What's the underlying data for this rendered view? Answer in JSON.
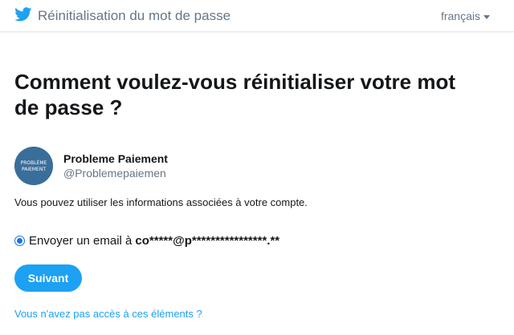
{
  "header": {
    "logo_icon": "twitter-bird-icon",
    "title": "Réinitialisation du mot de passe",
    "language": "français",
    "brand_color": "#1da1f2"
  },
  "main": {
    "heading": "Comment voulez-vous réinitialiser votre mot de passe ?",
    "account": {
      "name": "Probleme Paiement",
      "handle": "@Problemepaiemen",
      "avatar_text_line1": "PROBLÈME",
      "avatar_text_line2": "PAIEMENT"
    },
    "info_text": "Vous pouvez utiliser les informations associées à votre compte.",
    "option": {
      "label": "Envoyer un email à",
      "email": "co*****@p****************.**",
      "selected": true
    },
    "next_button": "Suivant",
    "help_link": "Vous n'avez pas accès à ces éléments ?"
  }
}
